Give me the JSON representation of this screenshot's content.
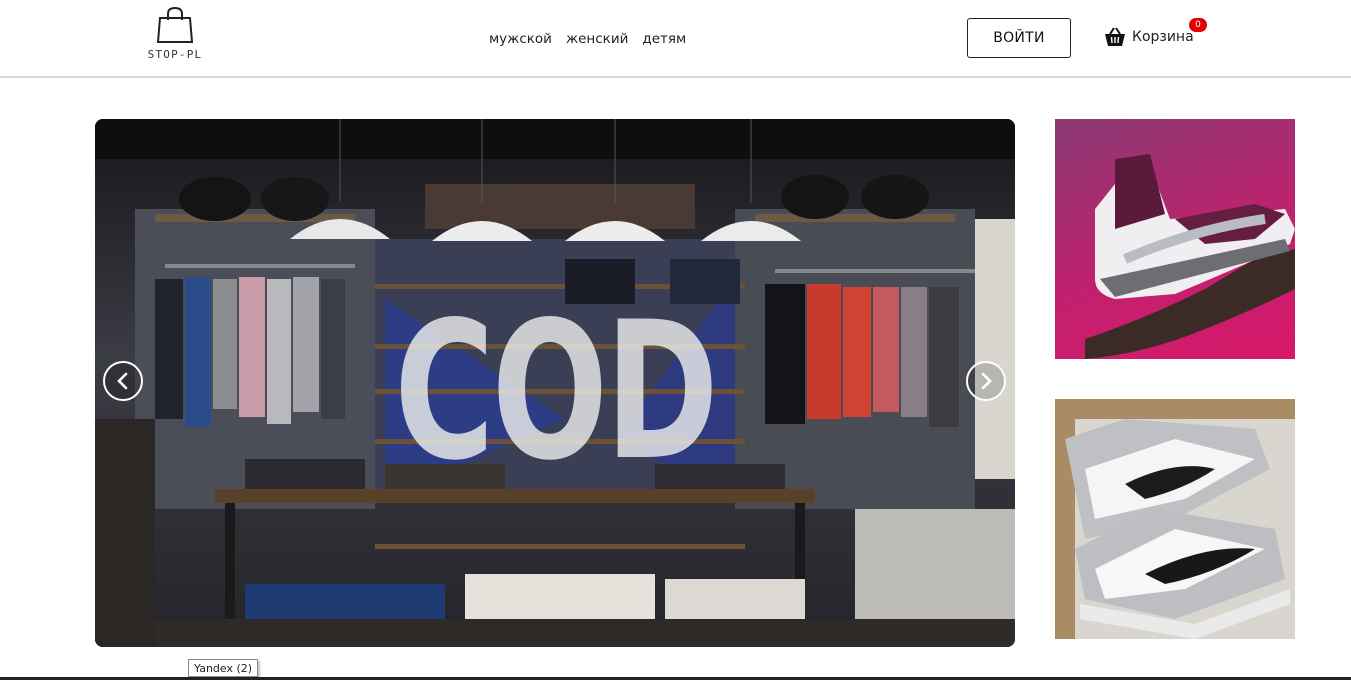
{
  "brand": {
    "name": "STOP-PL",
    "icon": "shopping-bag-icon"
  },
  "nav": {
    "items": [
      {
        "label": "мужской"
      },
      {
        "label": "женский"
      },
      {
        "label": "детям"
      }
    ]
  },
  "header": {
    "login_label": "ВОЙТИ",
    "cart_label": "Корзина",
    "cart_count": "0",
    "cart_icon": "basket-icon"
  },
  "hero": {
    "overlay_text": "COD",
    "prev_icon": "chevron-left-icon",
    "next_icon": "chevron-right-icon"
  },
  "tooltip": {
    "text": "Yandex (2)"
  },
  "colors": {
    "badge": "#e00000",
    "text": "#222222",
    "border": "#d8d8d8"
  }
}
